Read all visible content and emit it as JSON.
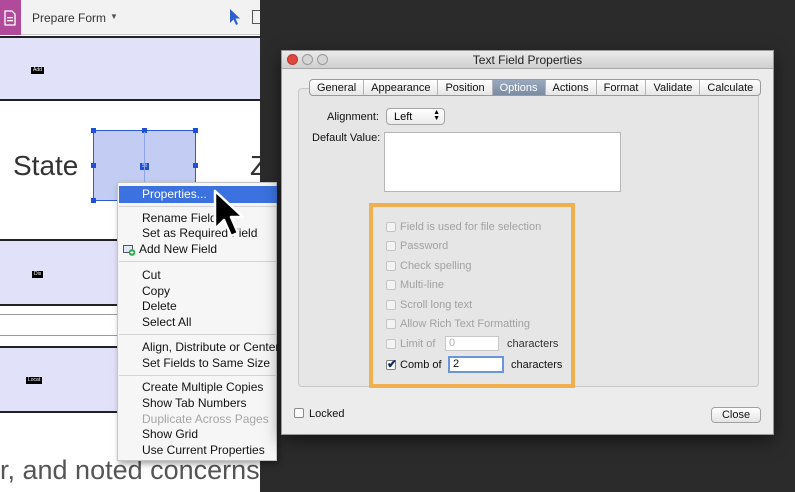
{
  "toolbar": {
    "prepare_form_label": "Prepare Form"
  },
  "document": {
    "state_label": "State",
    "zip_fragment": "Z",
    "bottom_text": "r, and noted concerns",
    "band_tags": [
      "Add",
      "Dis",
      "Locat"
    ],
    "state_field_tag": "St"
  },
  "context_menu": {
    "items": [
      "Properties...",
      "Rename Field",
      "Set as Required Field",
      "Add New Field",
      "Cut",
      "Copy",
      "Delete",
      "Select All",
      "Align, Distribute or Center",
      "Set Fields to Same Size",
      "Create Multiple Copies",
      "Show Tab Numbers",
      "Duplicate Across Pages",
      "Show Grid",
      "Use Current Properties"
    ]
  },
  "dialog": {
    "title": "Text Field Properties",
    "tabs": [
      "General",
      "Appearance",
      "Position",
      "Options",
      "Actions",
      "Format",
      "Validate",
      "Calculate"
    ],
    "active_tab": "Options",
    "alignment_label": "Alignment:",
    "alignment_value": "Left",
    "default_value_label": "Default Value:",
    "default_value": "",
    "options": [
      {
        "label": "Field is used for file selection",
        "checked": false,
        "enabled": false
      },
      {
        "label": "Password",
        "checked": false,
        "enabled": false
      },
      {
        "label": "Check spelling",
        "checked": false,
        "enabled": false
      },
      {
        "label": "Multi-line",
        "checked": false,
        "enabled": false
      },
      {
        "label": "Scroll long text",
        "checked": false,
        "enabled": false
      },
      {
        "label": "Allow Rich Text Formatting",
        "checked": false,
        "enabled": false
      },
      {
        "label": "Limit of",
        "checked": false,
        "enabled": false
      },
      {
        "label": "Comb of",
        "checked": true,
        "enabled": true
      }
    ],
    "limit_value": "0",
    "limit_suffix": "characters",
    "comb_value": "2",
    "comb_suffix": "characters",
    "locked_label": "Locked",
    "close_label": "Close"
  },
  "colors": {
    "highlight": "#f0b04f",
    "menu_selection": "#3b72e0",
    "field_band": "#e1e1f9",
    "tool_icon": "#b14a9a"
  }
}
